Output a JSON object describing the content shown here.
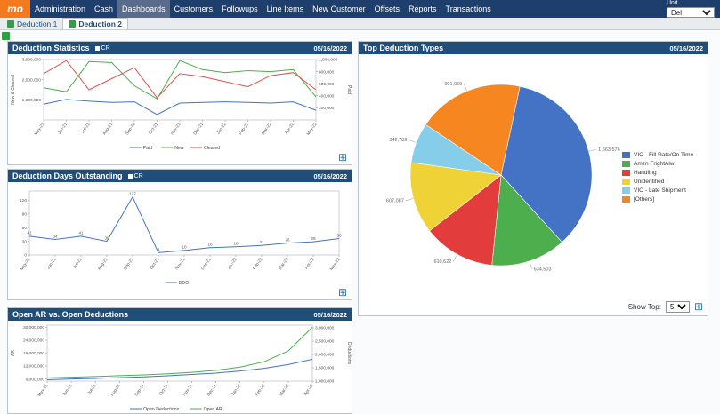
{
  "nav": {
    "brand": "mo",
    "items": [
      "Administration",
      "Cash",
      "Dashboards",
      "Customers",
      "Followups",
      "Line Items",
      "New Customer",
      "Offsets",
      "Reports",
      "Transactions"
    ],
    "active": "Dashboards",
    "unit_label": "Unit",
    "unit_value": "Del"
  },
  "tabs": {
    "items": [
      {
        "label": "Deduction 1",
        "active": false
      },
      {
        "label": "Deduction 2",
        "active": true
      }
    ]
  },
  "panels": {
    "stats": {
      "title": "Deduction Statistics",
      "badge": "CR",
      "date": "05/16/2022"
    },
    "ddo": {
      "title": "Deduction Days Outstanding",
      "badge": "CR",
      "date": "05/16/2022"
    },
    "open": {
      "title": "Open AR vs. Open Deductions",
      "date": "05/16/2022"
    },
    "pie": {
      "title": "Top Deduction Types",
      "date": "05/16/2022",
      "show_top_label": "Show Top:",
      "show_top_value": "5"
    }
  },
  "chart_data": [
    {
      "type": "line",
      "title": "Deduction Statistics",
      "categories": [
        "May-21",
        "Jun-21",
        "Jul-21",
        "Aug-21",
        "Sep-21",
        "Oct-21",
        "Nov-21",
        "Dec-21",
        "Jan-22",
        "Feb-22",
        "Mar-22",
        "Apr-22",
        "May-22"
      ],
      "series": [
        {
          "name": "Paid",
          "color": "#4472c4",
          "axis": "right",
          "values": [
            260000,
            340000,
            310000,
            290000,
            300000,
            90000,
            280000,
            290000,
            300000,
            290000,
            280000,
            300000,
            160000
          ]
        },
        {
          "name": "New",
          "color": "#4cae4c",
          "axis": "left",
          "values": [
            1600000,
            1400000,
            2900000,
            2850000,
            1700000,
            1050000,
            2950000,
            2500000,
            2350000,
            2450000,
            2400000,
            2500000,
            1150000
          ]
        },
        {
          "name": "Cleared",
          "color": "#d9534f",
          "axis": "left",
          "values": [
            2300000,
            2950000,
            1500000,
            2050000,
            2600000,
            1100000,
            2300000,
            2150000,
            1900000,
            1650000,
            2200000,
            2350000,
            1500000
          ]
        }
      ],
      "left_axis": {
        "label": "New & Cleared",
        "min": 0,
        "max": 3000000,
        "ticks": [
          1000000,
          2000000,
          3000000
        ]
      },
      "right_axis": {
        "label": "Paid",
        "min": 0,
        "max": 1000000,
        "ticks": [
          200000,
          400000,
          600000,
          800000,
          1000000
        ]
      },
      "legend_position": "bottom"
    },
    {
      "type": "line",
      "title": "Deduction Days Outstanding",
      "categories": [
        "May-21",
        "Jun-21",
        "Jul-21",
        "Aug-21",
        "Sep-21",
        "Oct-21",
        "Nov-21",
        "Dec-21",
        "Jan-22",
        "Feb-22",
        "Mar-22",
        "Apr-22",
        "May-22"
      ],
      "series": [
        {
          "name": "DDO",
          "color": "#4472c4",
          "axis": "left",
          "point_labels": true,
          "values": [
            41,
            34,
            41,
            30,
            127,
            5,
            10,
            16,
            18,
            21,
            26,
            29,
            36
          ]
        }
      ],
      "left_axis": {
        "min": 0,
        "max": 140,
        "ticks": [
          0,
          30,
          60,
          90,
          120
        ]
      },
      "legend_position": "bottom"
    },
    {
      "type": "line",
      "title": "Open AR vs. Open Deductions",
      "categories": [
        "May-21",
        "Jun-21",
        "Jul-21",
        "Aug-21",
        "Sep-21",
        "Oct-21",
        "Nov-21",
        "Dec-21",
        "Jan-22",
        "Feb-22",
        "Mar-22",
        "Apr-22"
      ],
      "series": [
        {
          "name": "Open Deductions",
          "color": "#4472c4",
          "axis": "right",
          "values": [
            1050000,
            1080000,
            1100000,
            1130000,
            1160000,
            1200000,
            1250000,
            1300000,
            1380000,
            1480000,
            1620000,
            1820000
          ]
        },
        {
          "name": "Open AR",
          "color": "#4cae4c",
          "axis": "left",
          "values": [
            6500000,
            6800000,
            7100000,
            7500000,
            7900000,
            8400000,
            9100000,
            10000000,
            11500000,
            14000000,
            19000000,
            30000000
          ]
        }
      ],
      "left_axis": {
        "label": "AR",
        "min": 5000000,
        "max": 31000000,
        "ticks": [
          6000000,
          12000000,
          18000000,
          24000000,
          30000000
        ]
      },
      "right_axis": {
        "label": "Deductions",
        "min": 1000000,
        "max": 3100000,
        "ticks": [
          1000000,
          1500000,
          2000000,
          2500000,
          3000000
        ]
      },
      "legend_position": "bottom"
    },
    {
      "type": "pie",
      "title": "Top Deduction Types",
      "start_angle_deg": 12,
      "slices": [
        {
          "label": "VIO - Fill Rate/On Time",
          "value": 1663576,
          "color": "#4472c4"
        },
        {
          "label": "Amzn FrightAlw",
          "value": 634503,
          "color": "#4cae4c"
        },
        {
          "label": "Handling",
          "value": 610622,
          "color": "#e23c3c"
        },
        {
          "label": "Unidentified",
          "value": 607087,
          "color": "#efd235"
        },
        {
          "label": "VIO - Late Shipment",
          "value": 342789,
          "color": "#85cde8"
        },
        {
          "label": "[Others]",
          "value": 901069,
          "color": "#f6861f"
        }
      ],
      "legend_position": "right"
    }
  ]
}
